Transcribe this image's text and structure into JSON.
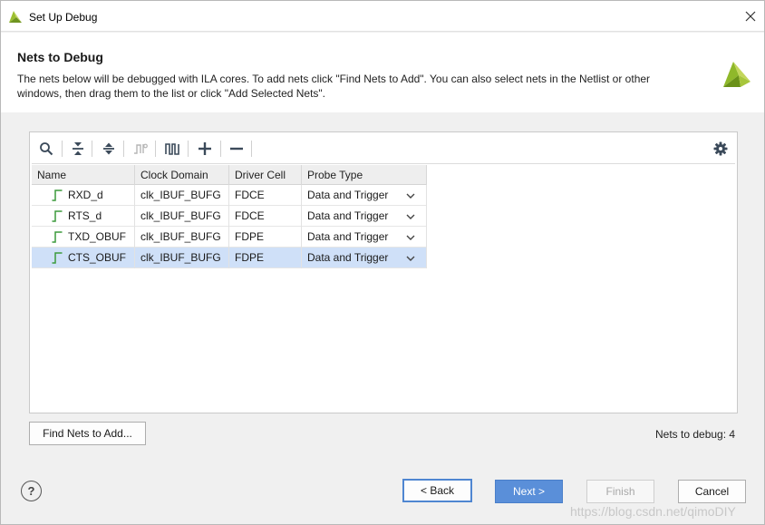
{
  "window": {
    "title": "Set Up Debug"
  },
  "header": {
    "title": "Nets to Debug",
    "description": "The nets below will be debugged with ILA cores. To add nets click \"Find Nets to Add\". You can also select nets in the Netlist or other windows, then drag them to the list or click \"Add Selected Nets\"."
  },
  "toolbar": {
    "icons": [
      "search-icon",
      "collapse-all-icon",
      "expand-all-icon",
      "probe-disabled-icon",
      "waveform-icon",
      "add-icon",
      "remove-icon",
      "gear-icon"
    ]
  },
  "table": {
    "columns": [
      "Name",
      "Clock Domain",
      "Driver Cell",
      "Probe Type"
    ],
    "rows": [
      {
        "name": "RXD_d",
        "clock": "clk_IBUF_BUFG",
        "driver": "FDCE",
        "probe": "Data and Trigger",
        "selected": false
      },
      {
        "name": "RTS_d",
        "clock": "clk_IBUF_BUFG",
        "driver": "FDCE",
        "probe": "Data and Trigger",
        "selected": false
      },
      {
        "name": "TXD_OBUF",
        "clock": "clk_IBUF_BUFG",
        "driver": "FDPE",
        "probe": "Data and Trigger",
        "selected": false
      },
      {
        "name": "CTS_OBUF",
        "clock": "clk_IBUF_BUFG",
        "driver": "FDPE",
        "probe": "Data and Trigger",
        "selected": true
      }
    ]
  },
  "buttons": {
    "find_nets": "Find Nets to Add...",
    "back": "< Back",
    "next": "Next >",
    "finish": "Finish",
    "cancel": "Cancel",
    "help": "?"
  },
  "status": {
    "nets_to_debug": "Nets to debug: 4"
  },
  "watermark": "https://blog.csdn.net/qimoDIY",
  "colors": {
    "accent": "#5a8fd9",
    "selected_row": "#cfe0f8",
    "logo": "#8fb82a"
  }
}
